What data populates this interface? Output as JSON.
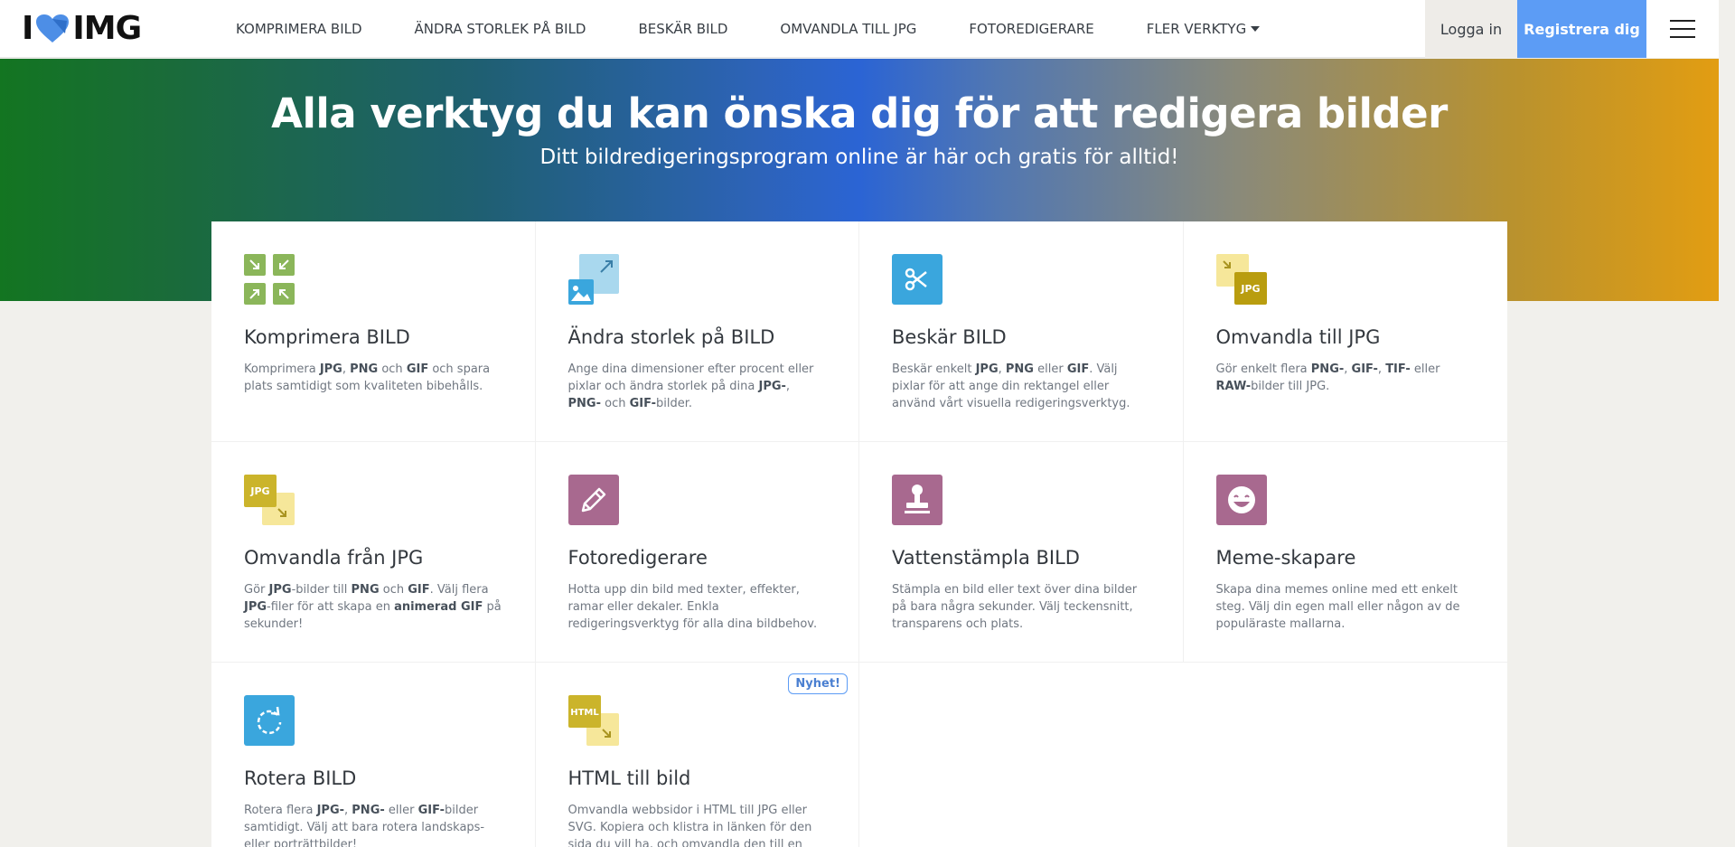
{
  "nav": {
    "logo_left": "I",
    "logo_right": "IMG",
    "links": [
      {
        "label": "KOMPRIMERA BILD"
      },
      {
        "label": "ÄNDRA STORLEK PÅ BILD"
      },
      {
        "label": "BESKÄR BILD"
      },
      {
        "label": "OMVANDLA TILL JPG"
      },
      {
        "label": "FOTOREDIGERARE"
      },
      {
        "label": "FLER VERKTYG"
      }
    ],
    "login": "Logga in",
    "register": "Registrera dig"
  },
  "hero": {
    "title": "Alla verktyg du kan önska dig för att redigera bilder",
    "subtitle": "Ditt bildredigeringsprogram online är här och gratis för alltid!"
  },
  "tools": [
    {
      "title": "Komprimera BILD",
      "icon": "compress-icon",
      "desc_parts": [
        [
          "Komprimera ",
          0
        ],
        [
          "JPG",
          1
        ],
        [
          ", ",
          0
        ],
        [
          "PNG",
          1
        ],
        [
          " och ",
          0
        ],
        [
          "GIF",
          1
        ],
        [
          " och spara plats samtidigt som kvaliteten bibehålls.",
          0
        ]
      ]
    },
    {
      "title": "Ändra storlek på BILD",
      "icon": "resize-icon",
      "desc_parts": [
        [
          "Ange dina dimensioner efter procent eller pixlar och ändra storlek på dina ",
          0
        ],
        [
          "JPG-",
          1
        ],
        [
          ", ",
          0
        ],
        [
          "PNG-",
          1
        ],
        [
          " och ",
          0
        ],
        [
          "GIF-",
          1
        ],
        [
          "bilder.",
          0
        ]
      ]
    },
    {
      "title": "Beskär BILD",
      "icon": "scissors-icon",
      "desc_parts": [
        [
          "Beskär enkelt ",
          0
        ],
        [
          "JPG",
          1
        ],
        [
          ", ",
          0
        ],
        [
          "PNG",
          1
        ],
        [
          " eller ",
          0
        ],
        [
          "GIF",
          1
        ],
        [
          ". Välj pixlar för att ange din rektangel eller använd vårt visuella redigeringsverktyg.",
          0
        ]
      ]
    },
    {
      "title": "Omvandla till JPG",
      "icon": "convert-to-jpg-icon",
      "icon_text": "JPG",
      "desc_parts": [
        [
          "Gör enkelt flera ",
          0
        ],
        [
          "PNG-",
          1
        ],
        [
          ", ",
          0
        ],
        [
          "GIF-",
          1
        ],
        [
          ", ",
          0
        ],
        [
          "TIF-",
          1
        ],
        [
          " eller ",
          0
        ],
        [
          "RAW-",
          1
        ],
        [
          "bilder till JPG.",
          0
        ]
      ]
    },
    {
      "title": "Omvandla från JPG",
      "icon": "convert-from-jpg-icon",
      "icon_text": "JPG",
      "desc_parts": [
        [
          "Gör ",
          0
        ],
        [
          "JPG",
          1
        ],
        [
          "-bilder till ",
          0
        ],
        [
          "PNG",
          1
        ],
        [
          " och ",
          0
        ],
        [
          "GIF",
          1
        ],
        [
          ". Välj flera ",
          0
        ],
        [
          "JPG",
          1
        ],
        [
          "-filer för att skapa en ",
          0
        ],
        [
          "animerad GIF",
          1
        ],
        [
          " på sekunder!",
          0
        ]
      ]
    },
    {
      "title": "Fotoredigerare",
      "icon": "pencil-icon",
      "desc_parts": [
        [
          "Hotta upp din bild med texter, effekter, ramar eller dekaler. Enkla redigeringsverktyg för alla dina bildbehov.",
          0
        ]
      ]
    },
    {
      "title": "Vattenstämpla BILD",
      "icon": "stamp-icon",
      "desc_parts": [
        [
          "Stämpla en bild eller text över dina bilder på bara några sekunder. Välj teckensnitt, transparens och plats.",
          0
        ]
      ]
    },
    {
      "title": "Meme-skapare",
      "icon": "meme-face-icon",
      "desc_parts": [
        [
          "Skapa dina memes online med ett enkelt steg. Välj din egen mall eller någon av de populäraste mallarna.",
          0
        ]
      ]
    },
    {
      "title": "Rotera BILD",
      "icon": "rotate-icon",
      "desc_parts": [
        [
          "Rotera flera ",
          0
        ],
        [
          "JPG-",
          1
        ],
        [
          ", ",
          0
        ],
        [
          "PNG-",
          1
        ],
        [
          " eller ",
          0
        ],
        [
          "GIF-",
          1
        ],
        [
          "bilder samtidigt. Välj att bara rotera landskaps- eller porträttbilder!",
          0
        ]
      ]
    },
    {
      "title": "HTML till bild",
      "icon": "html-to-image-icon",
      "icon_text": "HTML",
      "badge": "Nyhet!",
      "desc_parts": [
        [
          "Omvandla webbsidor i HTML till JPG eller SVG. Kopiera och klistra in länken för den sida du vill ha, och omvandla den till en",
          0
        ]
      ]
    }
  ],
  "colors": {
    "green": "#8bb65a",
    "blue": "#3aa6dd",
    "light_blue": "#a9d8ee",
    "yellow": "#cbb42b",
    "light_yellow": "#f6e79a",
    "purple": "#a8698f",
    "accent": "#5c9cf5"
  }
}
